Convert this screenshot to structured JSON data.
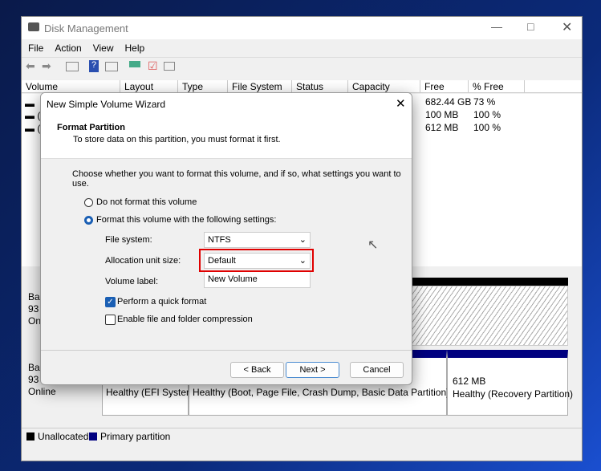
{
  "window": {
    "title": "Disk Management",
    "menu": [
      "File",
      "Action",
      "View",
      "Help"
    ]
  },
  "columns": [
    "Volume",
    "Layout",
    "Type",
    "File System",
    "Status",
    "Capacity",
    "Free Spa...",
    "% Free"
  ],
  "rows": [
    {
      "vol": "",
      "free": "682.44 GB",
      "pct": "73 %"
    },
    {
      "vol": "(",
      "free": "100 MB",
      "pct": "100 %"
    },
    {
      "vol": "(",
      "free": "612 MB",
      "pct": "100 %"
    }
  ],
  "disk0": {
    "l1": "Ba",
    "l2": "93",
    "l3": "On"
  },
  "disk1": {
    "l1": "Ba",
    "l2": "93",
    "l3": "Online",
    "p1": "Healthy (EFI Systen",
    "p2": "Healthy (Boot, Page File, Crash Dump, Basic Data Partition)",
    "p3size": "612 MB",
    "p3": "Healthy (Recovery Partition)"
  },
  "legend": {
    "unallocated": "Unallocated",
    "primary": "Primary partition",
    "unallocated_color": "#000000",
    "primary_color": "#000080"
  },
  "dialog": {
    "title": "New Simple Volume Wizard",
    "heading": "Format Partition",
    "subheading": "To store data on this partition, you must format it first.",
    "prompt": "Choose whether you want to format this volume, and if so, what settings you want to use.",
    "opt_noformat": "Do not format this volume",
    "opt_format": "Format this volume with the following settings:",
    "fs_label": "File system:",
    "fs_value": "NTFS",
    "alloc_label": "Allocation unit size:",
    "alloc_value": "Default",
    "vol_label": "Volume label:",
    "vol_value": "New Volume",
    "quick": "Perform a quick format",
    "quick_checked": true,
    "compress": "Enable file and folder compression",
    "compress_checked": false,
    "back": "< Back",
    "next": "Next >",
    "cancel": "Cancel",
    "highlight_color": "#e00000"
  }
}
